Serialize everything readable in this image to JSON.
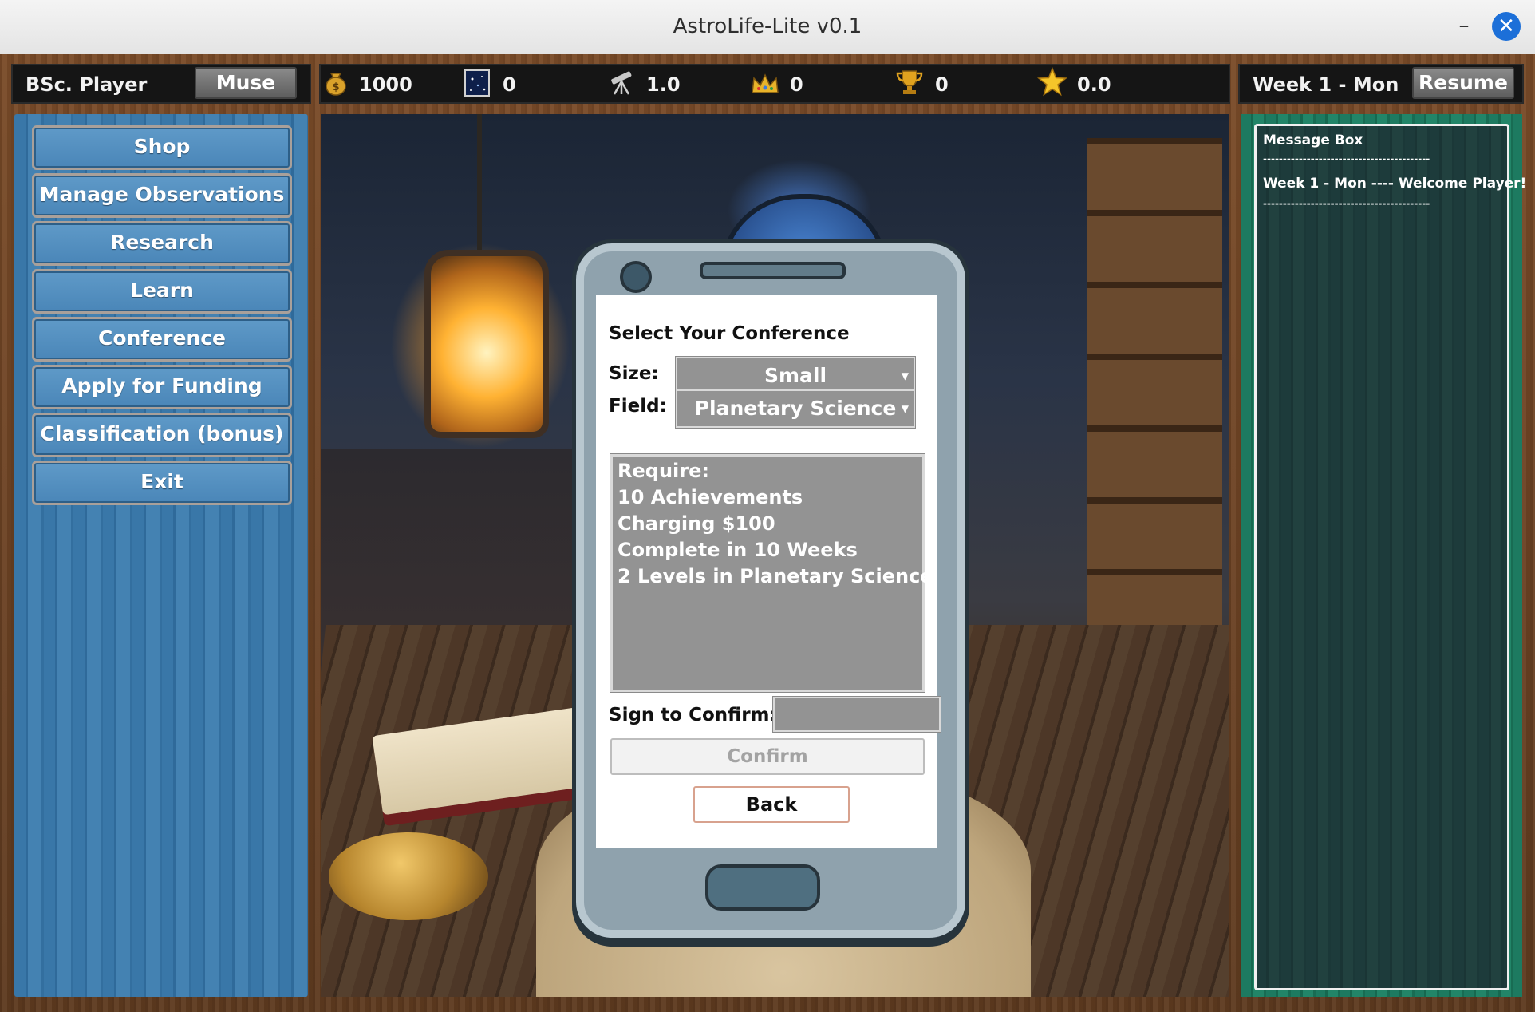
{
  "window": {
    "title": "AstroLife-Lite v0.1",
    "minimize": "–",
    "close": "✕"
  },
  "header_left": {
    "player": "BSc. Player",
    "muse_button": "Muse"
  },
  "stats": {
    "money": "1000",
    "observations": "0",
    "telescope": "1.0",
    "crowns": "0",
    "trophies": "0",
    "stars": "0.0"
  },
  "header_right": {
    "week": "Week 1 - Mon",
    "resume_button": "Resume"
  },
  "menu": [
    {
      "label": "Shop"
    },
    {
      "label": "Manage Observations"
    },
    {
      "label": "Research"
    },
    {
      "label": "Learn"
    },
    {
      "label": "Conference"
    },
    {
      "label": "Apply for Funding"
    },
    {
      "label": "Classification (bonus)"
    },
    {
      "label": "Exit"
    }
  ],
  "conference": {
    "title": "Select Your Conference",
    "size_label": "Size:",
    "size_value": "Small",
    "field_label": "Field:",
    "field_value": "Planetary Science",
    "requirements": [
      "Require:",
      "10 Achievements",
      "Charging $100",
      "Complete in 10 Weeks",
      "2 Levels in Planetary Science"
    ],
    "sign_label": "Sign to Confirm:",
    "sign_value": "",
    "confirm_button": "Confirm",
    "back_button": "Back"
  },
  "message_box": {
    "lines": [
      "Message Box",
      "------------------------------------------",
      "Week 1 - Mon ---- Welcome Player!",
      "------------------------------------------"
    ]
  },
  "colors": {
    "left_panel": "#3977a8",
    "right_panel": "#1d7a60",
    "dropdown": "#939393",
    "close_button": "#1c6fd8"
  }
}
